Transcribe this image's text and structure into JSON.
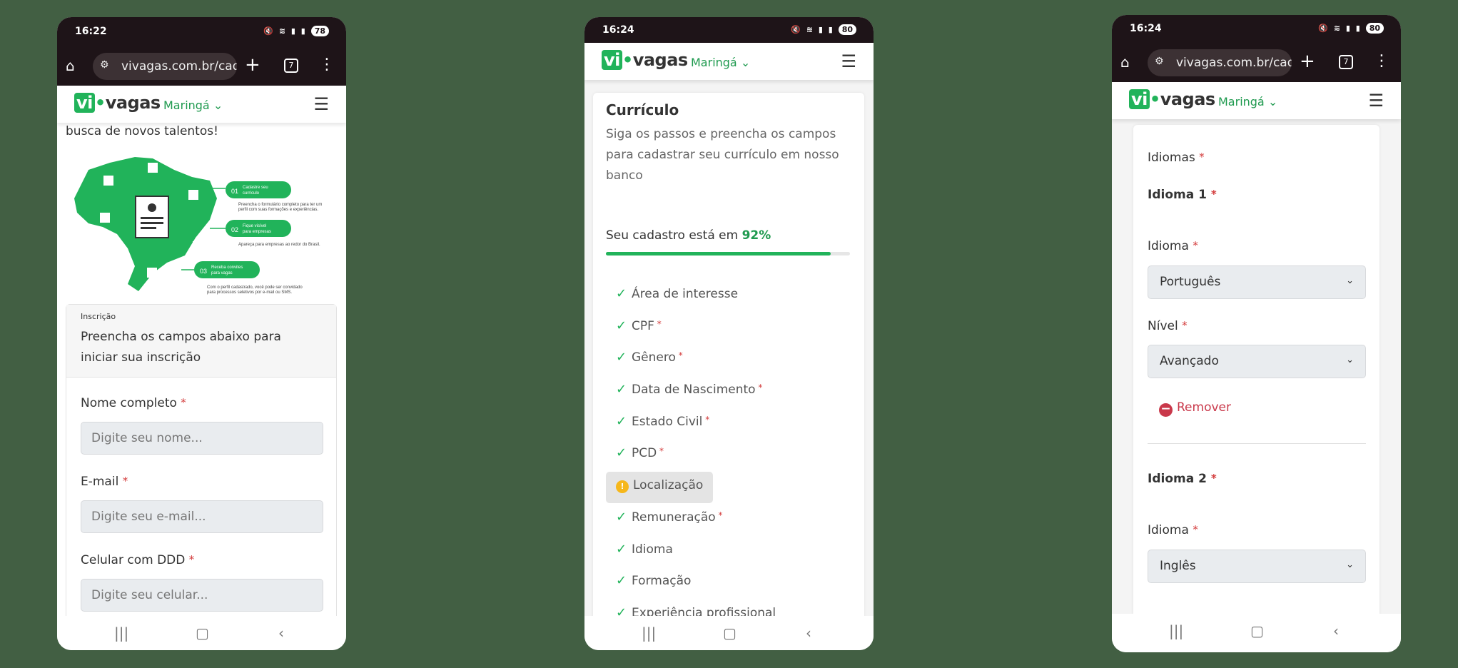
{
  "phone1": {
    "status": {
      "time": "16:22",
      "battery": "78"
    },
    "browser": {
      "url": "vivagas.com.br/cada",
      "tab_count": "7"
    },
    "header": {
      "logo_vi": "vi",
      "logo_rest": "vagas",
      "city": "Maringá"
    },
    "intro_text": "busca de novos talentos!",
    "infographic": {
      "step1_num": "01",
      "step1_title_a": "Cadastre seu",
      "step1_title_b": "currículo",
      "step1_desc_a": "Preencha o formulário completo para ter um",
      "step1_desc_b": "perfil com suas formações e experiências.",
      "step2_num": "02",
      "step2_title_a": "Fique visível",
      "step2_title_b": "para empresas",
      "step2_desc": "Apareça para empresas ao redor do Brasil.",
      "step3_num": "03",
      "step3_title_a": "Receba convites",
      "step3_title_b": "para vagas",
      "step3_desc_a": "Com o perfil cadastrado, você pode ser convidado",
      "step3_desc_b": "para processos seletivos por e-mail ou SMS."
    },
    "form": {
      "section": "Inscrição",
      "lead": "Preencha os campos abaixo para iniciar sua inscrição",
      "name_label": "Nome completo",
      "name_placeholder": "Digite seu nome...",
      "email_label": "E-mail",
      "email_placeholder": "Digite seu e-mail...",
      "phone_label": "Celular com DDD",
      "phone_placeholder": "Digite seu celular...",
      "required_mark": "*"
    }
  },
  "phone2": {
    "status": {
      "time": "16:24",
      "battery": "80"
    },
    "header": {
      "logo_vi": "vi",
      "logo_rest": "vagas",
      "city": "Maringá"
    },
    "card": {
      "title": "Currículo",
      "desc": "Siga os passos e preencha os campos para cadastrar seu currículo em nosso banco",
      "progress_label": "Seu cadastro está em",
      "progress_value": "92%",
      "progress_fraction": 0.92
    },
    "steps": [
      {
        "label": "Área de interesse",
        "required": false,
        "status": "done"
      },
      {
        "label": "CPF",
        "required": true,
        "status": "done"
      },
      {
        "label": "Gênero",
        "required": true,
        "status": "done"
      },
      {
        "label": "Data de Nascimento",
        "required": true,
        "status": "done"
      },
      {
        "label": "Estado Civil",
        "required": true,
        "status": "done"
      },
      {
        "label": "PCD",
        "required": true,
        "status": "done"
      },
      {
        "label": "Localização",
        "required": false,
        "status": "warning"
      },
      {
        "label": "Remuneração",
        "required": true,
        "status": "done"
      },
      {
        "label": "Idioma",
        "required": false,
        "status": "done"
      },
      {
        "label": "Formação",
        "required": false,
        "status": "done"
      },
      {
        "label": "Experiência profissional",
        "required": false,
        "status": "done"
      }
    ]
  },
  "phone3": {
    "status": {
      "time": "16:24",
      "battery": "80"
    },
    "browser": {
      "url": "vivagas.com.br/cada",
      "tab_count": "7"
    },
    "header": {
      "logo_vi": "vi",
      "logo_rest": "vagas",
      "city": "Maringá"
    },
    "form": {
      "section_label": "Idiomas",
      "lang1_title": "Idioma 1",
      "lang1_idioma_label": "Idioma",
      "lang1_idioma_value": "Português",
      "lang1_nivel_label": "Nível",
      "lang1_nivel_value": "Avançado",
      "remove_label": "Remover",
      "lang2_title": "Idioma 2",
      "lang2_idioma_label": "Idioma",
      "lang2_idioma_value": "Inglês",
      "required_mark": "*"
    }
  },
  "colors": {
    "brand_green": "#21b35a",
    "required_red": "#d33a3a",
    "remove_red": "#c9384a",
    "warning_yellow": "#f6b71a"
  }
}
